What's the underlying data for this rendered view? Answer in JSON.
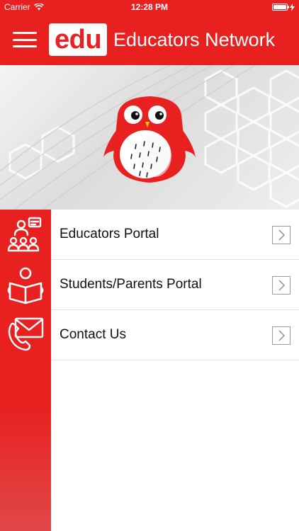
{
  "status_bar": {
    "carrier": "Carrier",
    "time": "12:28 PM",
    "battery_level": 1.0
  },
  "header": {
    "menu_icon": "hamburger-menu-icon",
    "logo_text": "edu",
    "title": "Educators Network"
  },
  "banner": {
    "image": "owl-mascot-on-hexagon-background"
  },
  "menu": {
    "items": [
      {
        "label": "Educators Portal",
        "icon": "teacher-classroom-icon"
      },
      {
        "label": "Students/Parents Portal",
        "icon": "student-reading-icon"
      },
      {
        "label": "Contact Us",
        "icon": "envelope-phone-icon"
      }
    ]
  },
  "colors": {
    "brand_red": "#e8201f",
    "white": "#ffffff",
    "divider": "#e3e3e3"
  }
}
